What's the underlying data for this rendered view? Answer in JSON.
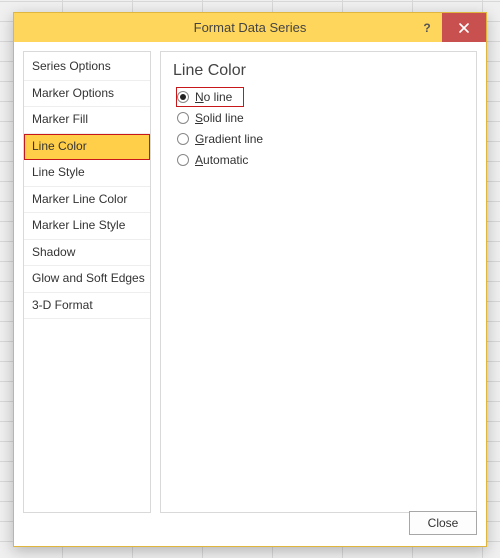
{
  "window": {
    "title": "Format Data Series",
    "help_glyph": "?",
    "close_name": "close-icon"
  },
  "sidebar": {
    "items": [
      {
        "label": "Series Options"
      },
      {
        "label": "Marker Options"
      },
      {
        "label": "Marker Fill"
      },
      {
        "label": "Line Color",
        "selected": true
      },
      {
        "label": "Line Style"
      },
      {
        "label": "Marker Line Color"
      },
      {
        "label": "Marker Line Style"
      },
      {
        "label": "Shadow"
      },
      {
        "label": "Glow and Soft Edges"
      },
      {
        "label": "3-D Format"
      }
    ]
  },
  "pane": {
    "heading": "Line Color",
    "options": [
      {
        "mn": "N",
        "rest": "o line",
        "checked": true,
        "highlight": true
      },
      {
        "mn": "S",
        "rest": "olid line",
        "checked": false
      },
      {
        "mn": "G",
        "rest": "radient line",
        "checked": false
      },
      {
        "mn": "A",
        "rest": "utomatic",
        "checked": false
      }
    ]
  },
  "footer": {
    "close_label": "Close"
  }
}
